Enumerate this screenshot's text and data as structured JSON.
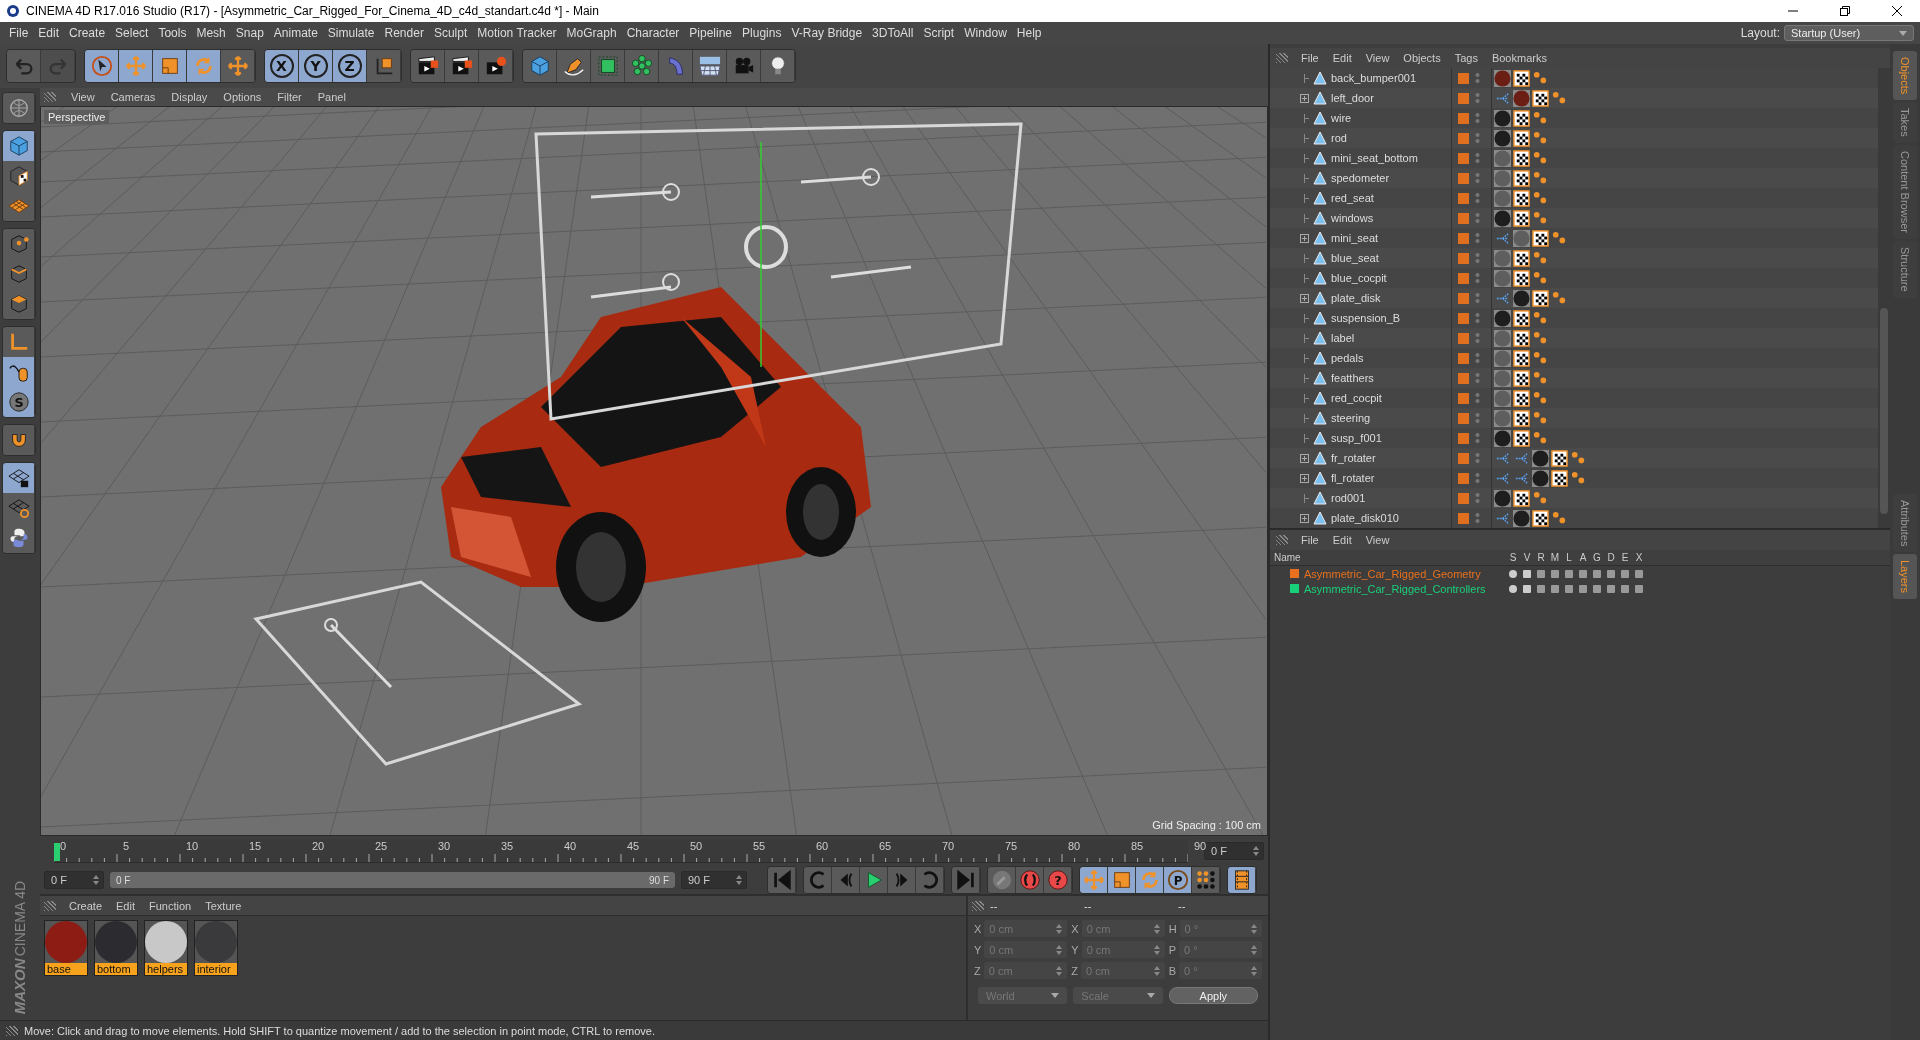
{
  "window": {
    "title": "CINEMA 4D R17.016 Studio (R17) - [Asymmetric_Car_Rigged_For_Cinema_4D_c4d_standart.c4d *] - Main"
  },
  "menu": [
    "File",
    "Edit",
    "Create",
    "Select",
    "Tools",
    "Mesh",
    "Snap",
    "Animate",
    "Simulate",
    "Render",
    "Sculpt",
    "Motion Tracker",
    "MoGraph",
    "Character",
    "Pipeline",
    "Plugins",
    "V-Ray Bridge",
    "3DToAll",
    "Script",
    "Window",
    "Help"
  ],
  "layout": {
    "label": "Layout:",
    "value": "Startup (User)"
  },
  "toolbar": [
    {
      "items": [
        {
          "kind": "undo",
          "active": false,
          "disabled": false
        },
        {
          "kind": "redo",
          "active": false,
          "disabled": true
        }
      ]
    },
    {
      "items": [
        {
          "kind": "select",
          "active": true,
          "disabled": false
        },
        {
          "kind": "move",
          "active": true,
          "disabled": false
        },
        {
          "kind": "scale",
          "active": true,
          "disabled": false
        },
        {
          "kind": "rotate",
          "active": true,
          "disabled": false
        },
        {
          "kind": "move",
          "active": false,
          "disabled": false
        }
      ]
    },
    {
      "items": [
        {
          "kind": "axis",
          "label": "X",
          "active": true,
          "disabled": false
        },
        {
          "kind": "axis",
          "label": "Y",
          "active": true,
          "disabled": false
        },
        {
          "kind": "axis",
          "label": "Z",
          "active": true,
          "disabled": false
        },
        {
          "kind": "coord",
          "active": false,
          "disabled": false
        }
      ]
    },
    {
      "items": [
        {
          "kind": "render",
          "active": false,
          "disabled": false
        },
        {
          "kind": "render",
          "active": false,
          "disabled": false
        },
        {
          "kind": "rendersettings",
          "active": false,
          "disabled": false
        }
      ]
    },
    {
      "items": [
        {
          "kind": "cube",
          "active": false,
          "disabled": false
        },
        {
          "kind": "pen",
          "active": false,
          "disabled": false
        },
        {
          "kind": "subdivide",
          "active": false,
          "disabled": false
        },
        {
          "kind": "cloner",
          "active": false,
          "disabled": false
        },
        {
          "kind": "bend",
          "active": false,
          "disabled": false
        },
        {
          "kind": "floor",
          "active": false,
          "disabled": false
        },
        {
          "kind": "camera",
          "active": false,
          "disabled": false
        },
        {
          "kind": "light",
          "active": false,
          "disabled": false
        }
      ]
    }
  ],
  "left_tools": [
    {
      "items": [
        {
          "kind": "globe",
          "active": false
        }
      ]
    },
    {
      "items": [
        {
          "kind": "cube",
          "active": true
        },
        {
          "kind": "texture",
          "active": false
        },
        {
          "kind": "grid",
          "active": false
        }
      ]
    },
    {
      "items": [
        {
          "kind": "points",
          "active": false
        },
        {
          "kind": "edges",
          "active": false
        },
        {
          "kind": "polygons",
          "active": false
        }
      ]
    },
    {
      "items": [
        {
          "kind": "axisl",
          "active": false
        },
        {
          "kind": "tweak",
          "active": true
        },
        {
          "kind": "solo",
          "label": "S",
          "active": true
        }
      ]
    },
    {
      "items": [
        {
          "kind": "magnet",
          "active": false
        }
      ]
    },
    {
      "items": [
        {
          "kind": "gridlock",
          "active": true
        },
        {
          "kind": "gridsync",
          "active": false
        },
        {
          "kind": "python",
          "active": false
        }
      ]
    }
  ],
  "logo": {
    "brand": "MAXON",
    "product": "CINEMA 4D"
  },
  "viewport": {
    "menu": [
      "View",
      "Cameras",
      "Display",
      "Options",
      "Filter",
      "Panel"
    ],
    "camera": "Perspective",
    "grid_spacing": "Grid Spacing : 100 cm"
  },
  "timeline": {
    "ticks": [
      "0",
      "5",
      "10",
      "15",
      "20",
      "25",
      "30",
      "35",
      "40",
      "45",
      "50",
      "55",
      "60",
      "65",
      "70",
      "75",
      "80",
      "85",
      "90"
    ],
    "current": "0 F",
    "start": "0 F",
    "range": {
      "start": "0 F",
      "end": "90 F",
      "level": 1
    },
    "end": "90 F"
  },
  "transport": [
    {
      "items": [
        {
          "kind": "first",
          "active": false
        }
      ]
    },
    {
      "items": [
        {
          "kind": "loopback",
          "active": false
        },
        {
          "kind": "prev",
          "active": false
        },
        {
          "kind": "play",
          "active": false
        },
        {
          "kind": "next",
          "active": false
        },
        {
          "kind": "loop",
          "active": false
        }
      ]
    },
    {
      "items": [
        {
          "kind": "last",
          "active": false
        }
      ]
    },
    {
      "items": [
        {
          "kind": "keyoff",
          "active": false
        },
        {
          "kind": "record",
          "active": false
        },
        {
          "kind": "autokey",
          "label": "?",
          "active": false
        }
      ]
    },
    {
      "items": [
        {
          "kind": "move",
          "active": true
        },
        {
          "kind": "scale",
          "active": true
        },
        {
          "kind": "rotate",
          "active": true
        },
        {
          "kind": "param",
          "label": "P",
          "active": true
        },
        {
          "kind": "dots",
          "active": false
        }
      ]
    },
    {
      "items": [
        {
          "kind": "film",
          "active": true
        }
      ]
    }
  ],
  "materials": {
    "menu": [
      "Create",
      "Edit",
      "Function",
      "Texture"
    ],
    "items": [
      {
        "name": "base",
        "color": "#8c1c14"
      },
      {
        "name": "bottom",
        "color": "#2c2c30"
      },
      {
        "name": "helpers",
        "color": "#c8c8c8"
      },
      {
        "name": "interior",
        "color": "#3a3a3c"
      }
    ]
  },
  "coordinates": {
    "headers": [
      "--",
      "--",
      "--"
    ],
    "rows": [
      [
        {
          "axis": "X",
          "value": "0 cm"
        },
        {
          "axis": "X",
          "value": "0 cm"
        },
        {
          "axis": "H",
          "value": "0 °"
        }
      ],
      [
        {
          "axis": "Y",
          "value": "0 cm"
        },
        {
          "axis": "Y",
          "value": "0 cm"
        },
        {
          "axis": "P",
          "value": "0 °"
        }
      ],
      [
        {
          "axis": "Z",
          "value": "0 cm"
        },
        {
          "axis": "Z",
          "value": "0 cm"
        },
        {
          "axis": "B",
          "value": "0 °"
        }
      ]
    ],
    "disabled": true,
    "space": "World",
    "mode": "Scale",
    "apply": "Apply"
  },
  "status_bar": "Move: Click and drag to move elements. Hold SHIFT to quantize movement / add to the selection in point mode, CTRL to remove.",
  "objects": {
    "menu": [
      "File",
      "Edit",
      "View",
      "Objects",
      "Tags",
      "Bookmarks"
    ],
    "rows": [
      {
        "name": "back_bumper001",
        "expandable": false,
        "tags": [
          {
            "kind": "material",
            "color": "#6a1e14"
          },
          {
            "kind": "texture"
          },
          {
            "kind": "selection"
          }
        ]
      },
      {
        "name": "left_door",
        "expandable": true,
        "tags": [
          {
            "kind": "link"
          },
          {
            "kind": "material",
            "color": "#6a1e14"
          },
          {
            "kind": "texture"
          },
          {
            "kind": "selection"
          }
        ]
      },
      {
        "name": "wire",
        "expandable": false,
        "tags": [
          {
            "kind": "material",
            "color": "#1e1e1e"
          },
          {
            "kind": "texture"
          },
          {
            "kind": "selection"
          }
        ]
      },
      {
        "name": "rod",
        "expandable": false,
        "tags": [
          {
            "kind": "material",
            "color": "#1e1e1e"
          },
          {
            "kind": "texture"
          },
          {
            "kind": "selection"
          }
        ]
      },
      {
        "name": "mini_seat_bottom",
        "expandable": false,
        "tags": [
          {
            "kind": "material",
            "color": "#5e5e5e"
          },
          {
            "kind": "texture"
          },
          {
            "kind": "selection"
          }
        ]
      },
      {
        "name": "spedometer",
        "expandable": false,
        "tags": [
          {
            "kind": "material",
            "color": "#5e5e5e"
          },
          {
            "kind": "texture"
          },
          {
            "kind": "selection"
          }
        ]
      },
      {
        "name": "red_seat",
        "expandable": false,
        "tags": [
          {
            "kind": "material",
            "color": "#5e5e5e"
          },
          {
            "kind": "texture"
          },
          {
            "kind": "selection"
          }
        ]
      },
      {
        "name": "windows",
        "expandable": false,
        "tags": [
          {
            "kind": "material",
            "color": "#1e1e1e"
          },
          {
            "kind": "texture"
          },
          {
            "kind": "selection"
          }
        ]
      },
      {
        "name": "mini_seat",
        "expandable": true,
        "tags": [
          {
            "kind": "link"
          },
          {
            "kind": "material",
            "color": "#5e5e5e"
          },
          {
            "kind": "texture"
          },
          {
            "kind": "selection"
          }
        ]
      },
      {
        "name": "blue_seat",
        "expandable": false,
        "tags": [
          {
            "kind": "material",
            "color": "#5e5e5e"
          },
          {
            "kind": "texture"
          },
          {
            "kind": "selection"
          }
        ]
      },
      {
        "name": "blue_cocpit",
        "expandable": false,
        "tags": [
          {
            "kind": "material",
            "color": "#5e5e5e"
          },
          {
            "kind": "texture"
          },
          {
            "kind": "selection"
          }
        ]
      },
      {
        "name": "plate_disk",
        "expandable": true,
        "tags": [
          {
            "kind": "link"
          },
          {
            "kind": "material",
            "color": "#1e1e1e"
          },
          {
            "kind": "texture"
          },
          {
            "kind": "selection"
          }
        ]
      },
      {
        "name": "suspension_B",
        "expandable": false,
        "tags": [
          {
            "kind": "material",
            "color": "#1e1e1e"
          },
          {
            "kind": "texture"
          },
          {
            "kind": "selection"
          }
        ]
      },
      {
        "name": "label",
        "expandable": false,
        "tags": [
          {
            "kind": "material",
            "color": "#5e5e5e"
          },
          {
            "kind": "texture"
          },
          {
            "kind": "selection"
          }
        ]
      },
      {
        "name": "pedals",
        "expandable": false,
        "tags": [
          {
            "kind": "material",
            "color": "#5e5e5e"
          },
          {
            "kind": "texture"
          },
          {
            "kind": "selection"
          }
        ]
      },
      {
        "name": "featthers",
        "expandable": false,
        "tags": [
          {
            "kind": "material",
            "color": "#5e5e5e"
          },
          {
            "kind": "texture"
          },
          {
            "kind": "selection"
          }
        ]
      },
      {
        "name": "red_cocpit",
        "expandable": false,
        "tags": [
          {
            "kind": "material",
            "color": "#5e5e5e"
          },
          {
            "kind": "texture"
          },
          {
            "kind": "selection"
          }
        ]
      },
      {
        "name": "steering",
        "expandable": false,
        "tags": [
          {
            "kind": "material",
            "color": "#5e5e5e"
          },
          {
            "kind": "texture"
          },
          {
            "kind": "selection"
          }
        ]
      },
      {
        "name": "susp_f001",
        "expandable": false,
        "tags": [
          {
            "kind": "material",
            "color": "#1e1e1e"
          },
          {
            "kind": "texture"
          },
          {
            "kind": "selection"
          }
        ]
      },
      {
        "name": "fr_rotater",
        "expandable": true,
        "tags": [
          {
            "kind": "link"
          },
          {
            "kind": "link"
          },
          {
            "kind": "material",
            "color": "#1e1e1e"
          },
          {
            "kind": "texture"
          },
          {
            "kind": "selection"
          }
        ]
      },
      {
        "name": "fl_rotater",
        "expandable": true,
        "tags": [
          {
            "kind": "link"
          },
          {
            "kind": "link"
          },
          {
            "kind": "material",
            "color": "#1e1e1e"
          },
          {
            "kind": "texture"
          },
          {
            "kind": "selection"
          }
        ]
      },
      {
        "name": "rod001",
        "expandable": false,
        "tags": [
          {
            "kind": "material",
            "color": "#1e1e1e"
          },
          {
            "kind": "texture"
          },
          {
            "kind": "selection"
          }
        ]
      },
      {
        "name": "plate_disk010",
        "expandable": true,
        "tags": [
          {
            "kind": "link"
          },
          {
            "kind": "material",
            "color": "#1e1e1e"
          },
          {
            "kind": "texture"
          },
          {
            "kind": "selection"
          }
        ]
      }
    ]
  },
  "layers": {
    "menu": [
      "File",
      "Edit",
      "View"
    ],
    "columns": [
      "Name",
      "S",
      "V",
      "R",
      "M",
      "L",
      "A",
      "G",
      "D",
      "E",
      "X"
    ],
    "rows": [
      {
        "name": "Asymmetric_Car_Rigged_Geometry",
        "color": "#e8701e"
      },
      {
        "name": "Asymmetric_Car_Rigged_Controllers",
        "color": "#19d07a"
      }
    ]
  },
  "side_tabs_top": [
    {
      "label": "Objects",
      "selected": true
    },
    {
      "label": "Takes",
      "selected": false
    },
    {
      "label": "Content Browser",
      "selected": false
    },
    {
      "label": "Structure",
      "selected": false
    }
  ],
  "side_tabs_bottom": [
    {
      "label": "Attributes",
      "selected": false
    },
    {
      "label": "Layers",
      "selected": true
    }
  ]
}
